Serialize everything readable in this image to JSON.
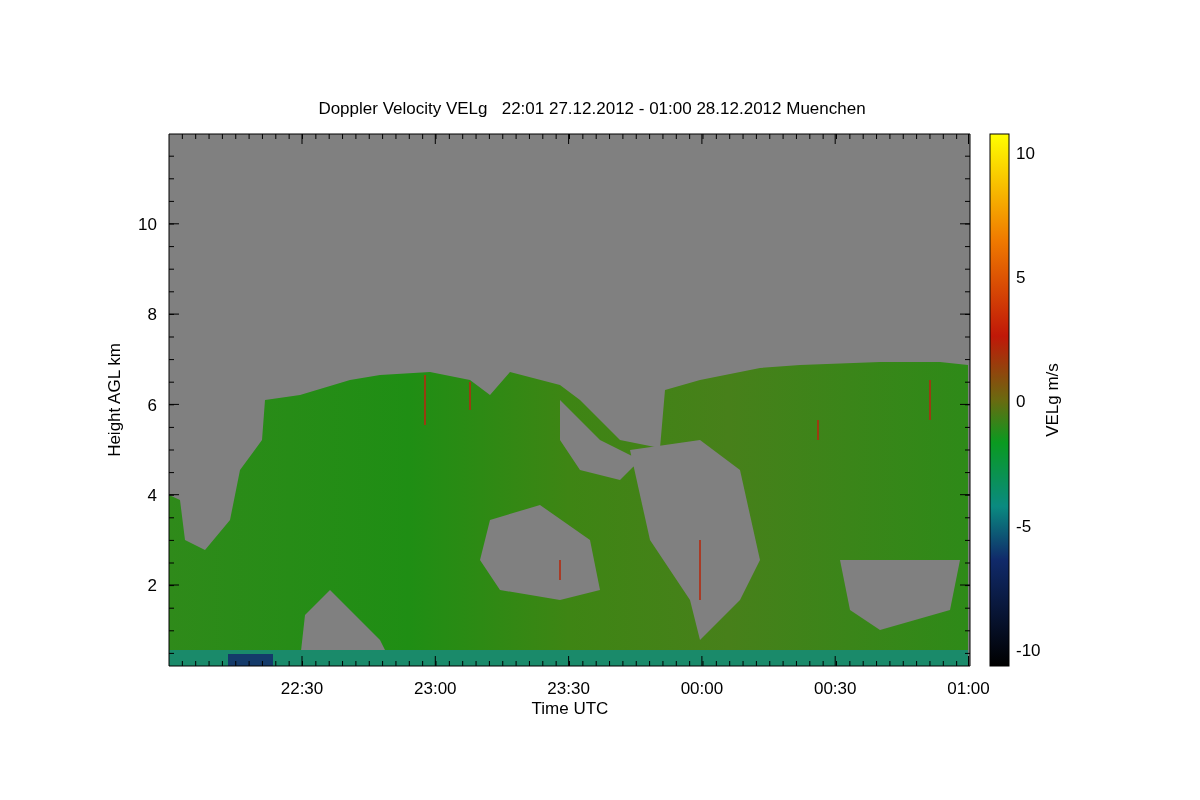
{
  "title": "Doppler Velocity VELg   22:01 27.12.2012 - 01:00 28.12.2012 Muenchen",
  "y_axis": {
    "label": "Height AGL km",
    "ticks": [
      "10",
      "8",
      "6",
      "4",
      "2"
    ]
  },
  "x_axis": {
    "label": "Time UTC",
    "ticks": [
      "22:30",
      "23:00",
      "23:30",
      "00:00",
      "00:30",
      "01:00"
    ]
  },
  "colorbar": {
    "label": "VELg m/s",
    "ticks": [
      "10",
      "5",
      "0",
      "-5",
      "-10"
    ]
  }
}
